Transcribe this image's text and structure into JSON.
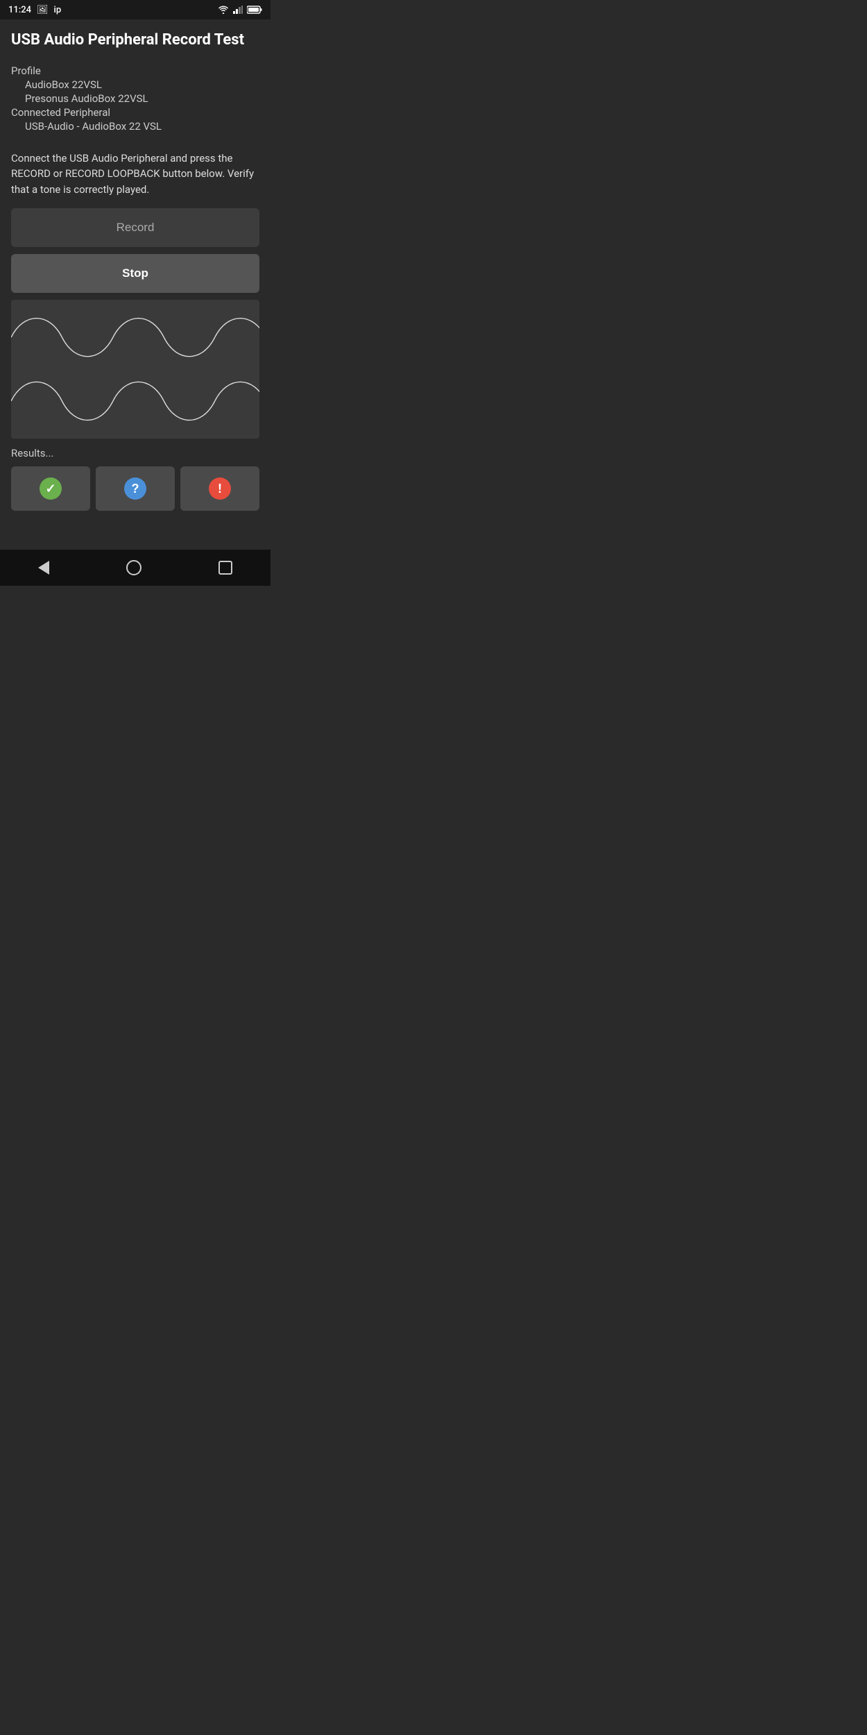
{
  "statusBar": {
    "time": "11:24",
    "icons": [
      "photo",
      "ip"
    ]
  },
  "header": {
    "title": "USB Audio Peripheral Record Test"
  },
  "profile": {
    "label": "Profile",
    "line1": "AudioBox 22VSL",
    "line2": "Presonus AudioBox 22VSL"
  },
  "connected": {
    "label": "Connected Peripheral",
    "device": "USB-Audio - AudioBox 22 VSL"
  },
  "instruction": "Connect the USB Audio Peripheral and press the RECORD or RECORD LOOPBACK button below. Verify that a tone is correctly played.",
  "buttons": {
    "record": "Record",
    "stop": "Stop"
  },
  "results": {
    "label": "Results..."
  },
  "resultButtons": [
    {
      "type": "check",
      "label": "Pass"
    },
    {
      "type": "question",
      "label": "Unknown"
    },
    {
      "type": "exclaim",
      "label": "Fail"
    }
  ]
}
